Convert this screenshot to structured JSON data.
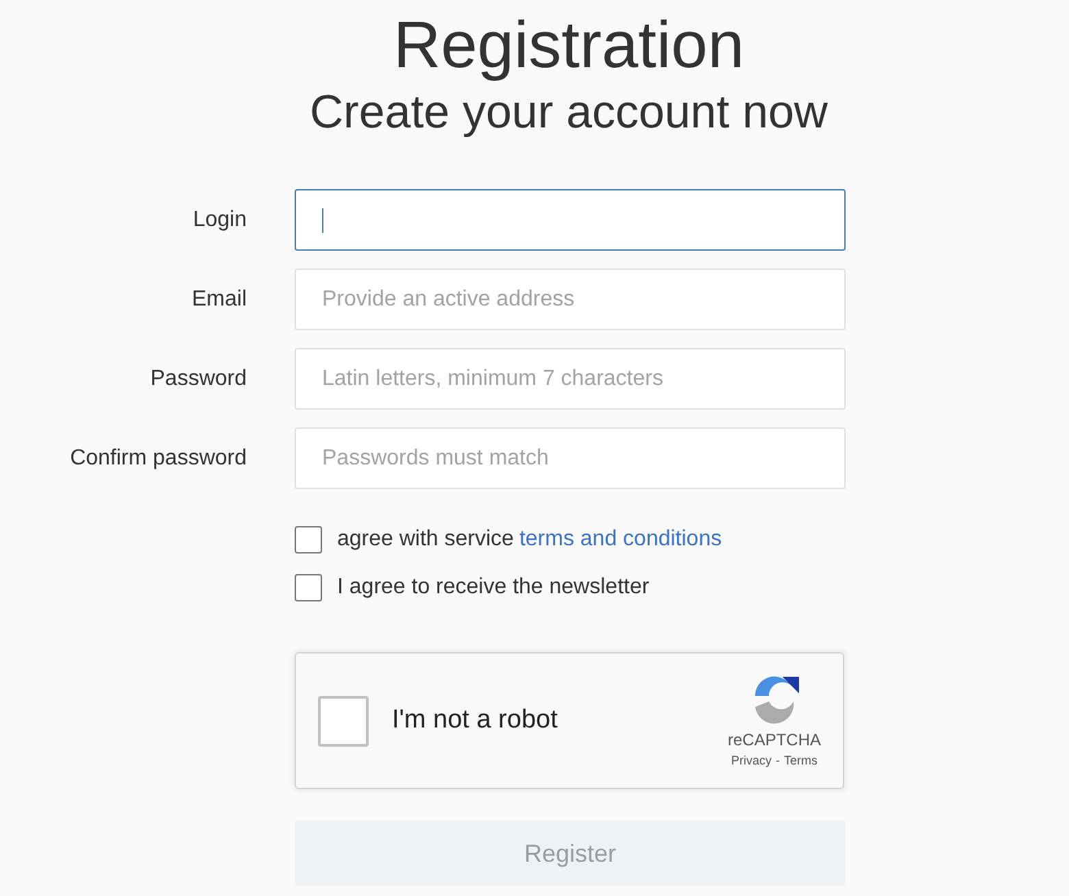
{
  "header": {
    "title": "Registration",
    "subtitle": "Create your account now"
  },
  "fields": [
    {
      "label": "Login",
      "focused": true
    },
    {
      "label": "Email",
      "placeholder": "Provide an active address",
      "focused": false
    },
    {
      "label": "Password",
      "placeholder": "Latin letters, minimum 7 characters",
      "focused": false
    },
    {
      "label": "Confirm password",
      "placeholder": "Passwords must match",
      "focused": false
    }
  ],
  "agreements": [
    {
      "text": "agree with service",
      "link": "terms and conditions",
      "checked": false
    },
    {
      "text": "I agree to receive the newsletter",
      "checked": false
    }
  ],
  "captcha": {
    "label": "I'm not a robot",
    "checked": false,
    "brand": "reCAPTCHA",
    "privacy_link": "Privacy",
    "separator": "-",
    "terms_link": "Terms"
  },
  "submit": {
    "label": "Register",
    "disabled": true
  }
}
